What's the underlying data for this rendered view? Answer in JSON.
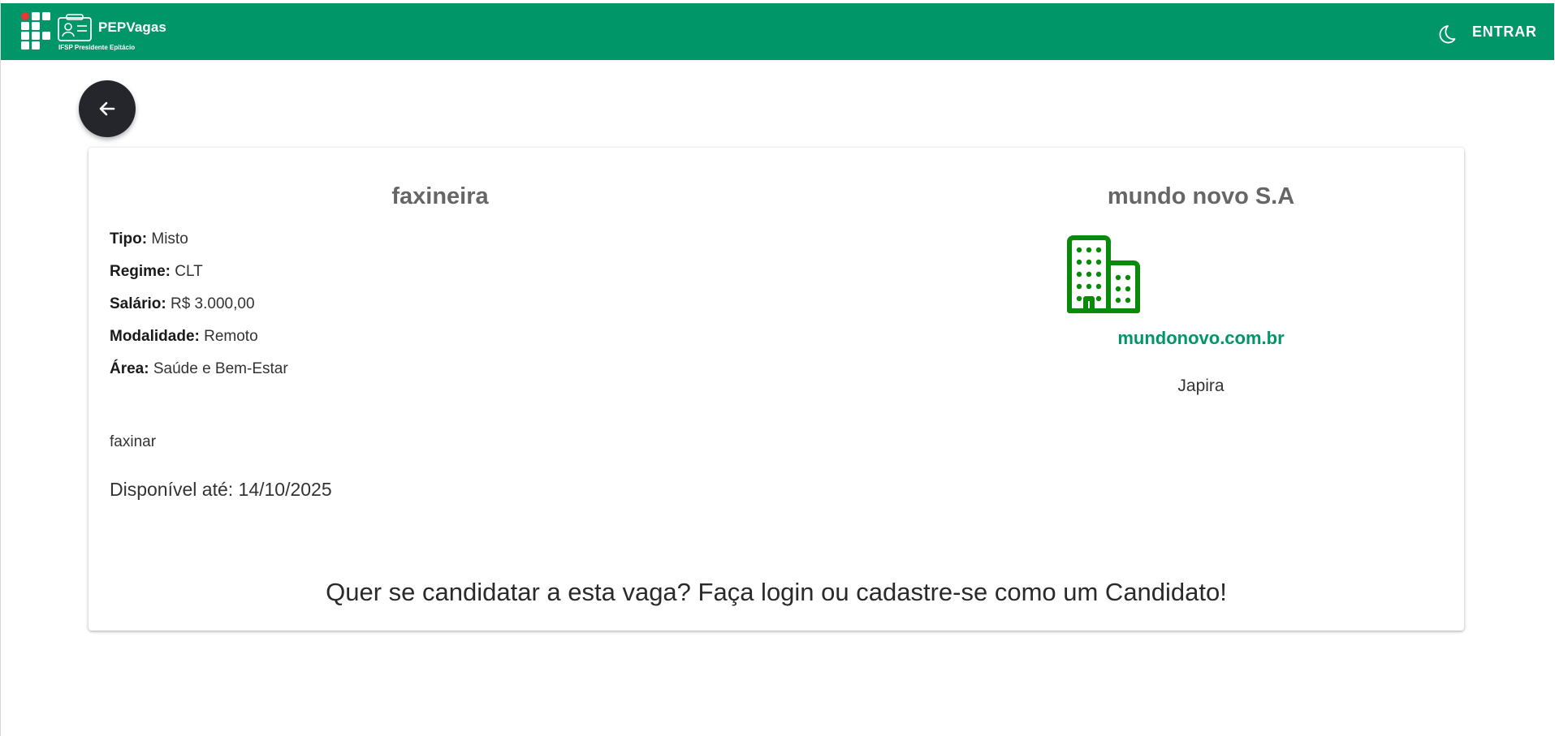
{
  "header": {
    "brand_name": "PEPVagas",
    "brand_subtitle": "IFSP Presidente Epitácio",
    "theme_toggle_icon": "moon-icon",
    "login_label": "ENTRAR",
    "bar_color": "#009668"
  },
  "back_button": {
    "icon": "arrow-left-icon"
  },
  "job": {
    "title": "faxineira",
    "fields": [
      {
        "label": "Tipo:",
        "value": "Misto"
      },
      {
        "label": "Regime:",
        "value": "CLT"
      },
      {
        "label": "Salário:",
        "value": "R$ 3.000,00"
      },
      {
        "label": "Modalidade:",
        "value": "Remoto"
      },
      {
        "label": "Área:",
        "value": "Saúde e Bem-Estar"
      }
    ],
    "description": "faxinar",
    "available_until": "Disponível até: 14/10/2025"
  },
  "company": {
    "name": "mundo novo S.A",
    "icon": "building-icon",
    "icon_color": "#0a8a0a",
    "website": "mundonovo.com.br",
    "city": "Japira"
  },
  "cta_text": "Quer se candidatar a esta vaga? Faça login ou cadastre-se como um Candidato!"
}
